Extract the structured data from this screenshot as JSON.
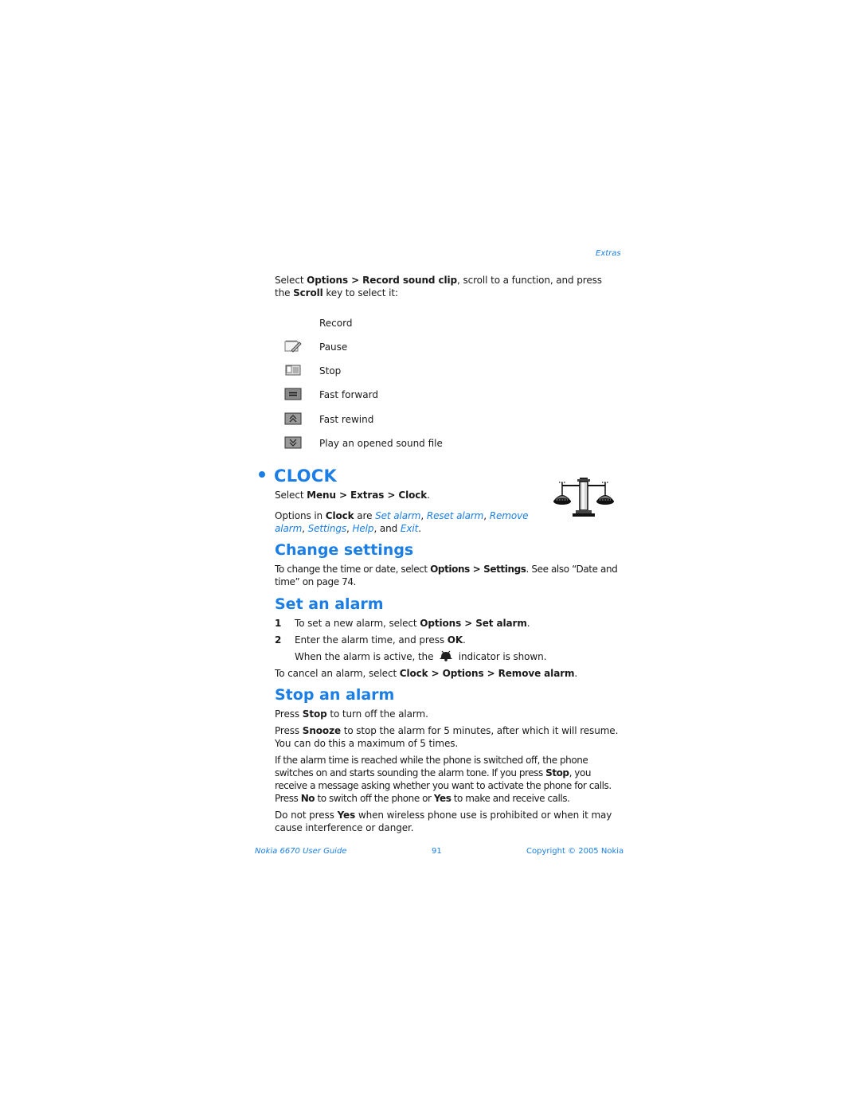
{
  "header": {
    "section": "Extras"
  },
  "intro": {
    "t1": "Select ",
    "b1": "Options > Record sound clip",
    "t2": ", scroll to a function, and press the ",
    "b2": "Scroll",
    "t3": " key to select it:"
  },
  "functions": [
    {
      "icon": "none",
      "label": "Record"
    },
    {
      "icon": "notepad-pencil-icon",
      "label": "Pause"
    },
    {
      "icon": "card-icon",
      "label": "Stop"
    },
    {
      "icon": "equals-button-icon",
      "label": "Fast forward"
    },
    {
      "icon": "up-chevrons-button-icon",
      "label": "Fast rewind"
    },
    {
      "icon": "down-chevrons-button-icon",
      "label": "Play an opened sound file"
    }
  ],
  "clock": {
    "title": "CLOCK",
    "select_t": "Select ",
    "select_b": "Menu > Extras > Clock",
    "select_end": ".",
    "opt_t1": "Options in ",
    "opt_b": "Clock",
    "opt_t2": " are ",
    "opt_links": [
      "Set alarm",
      "Reset alarm",
      "Remove alarm",
      "Settings",
      "Help",
      "Exit"
    ],
    "sep": ", ",
    "and": ", and ",
    "end": ".",
    "icon": "scales-icon"
  },
  "change_settings": {
    "title": "Change settings",
    "t1": "To change the time or date, select ",
    "b1": "Options > Settings",
    "t2": ". See also “Date and time” on page 74."
  },
  "set_alarm": {
    "title": "Set an alarm",
    "steps": [
      {
        "num": "1",
        "t1": "To set a new alarm, select ",
        "b1": "Options > Set alarm",
        "t2": "."
      },
      {
        "num": "2",
        "t1": "Enter the alarm time, and press ",
        "b1": "OK",
        "t2": "."
      }
    ],
    "note_t1": "When the alarm is active, the ",
    "note_t2": " indicator is shown.",
    "cancel_t1": "To cancel an alarm, select ",
    "cancel_b": "Clock > Options > Remove alarm",
    "cancel_t2": "."
  },
  "stop_alarm": {
    "title": "Stop an alarm",
    "p1_t1": "Press ",
    "p1_b": "Stop",
    "p1_t2": " to turn off the alarm.",
    "p2_t1": "Press ",
    "p2_b": "Snooze",
    "p2_t2": " to stop the alarm for 5 minutes, after which it will resume. You can do this a maximum of 5 times.",
    "p3_t1": "If the alarm time is reached while the phone is switched off, the phone switches on and starts sounding the alarm tone. If you press ",
    "p3_b1": "Stop",
    "p3_t2": ", you receive a message asking whether you want to activate the phone for calls. Press ",
    "p3_b2": "No",
    "p3_t3": " to switch off the phone or ",
    "p3_b3": "Yes",
    "p3_t4": " to make and receive calls.",
    "p4_t1": "Do not press ",
    "p4_b": "Yes",
    "p4_t2": " when wireless phone use is prohibited or when it may cause interference or danger."
  },
  "footer": {
    "left": "Nokia 6670 User Guide",
    "page": "91",
    "right": "Copyright © 2005 Nokia"
  }
}
